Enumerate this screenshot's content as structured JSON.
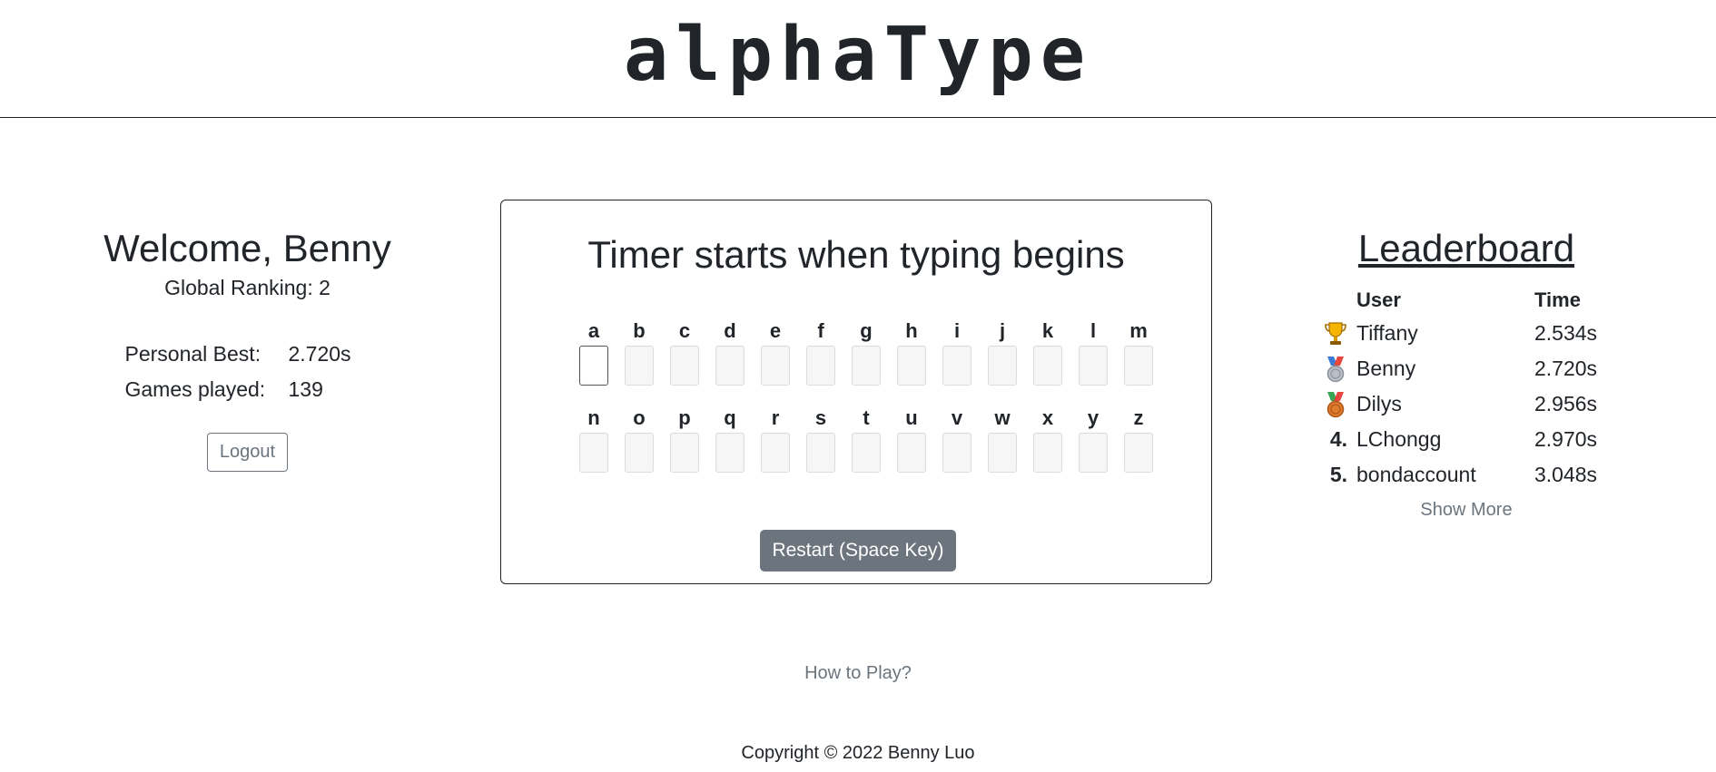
{
  "header": {
    "logo": "alphaType"
  },
  "profile": {
    "welcome": "Welcome, Benny",
    "ranking": "Global Ranking: 2",
    "stats": [
      {
        "label": "Personal Best:",
        "value": "2.720s"
      },
      {
        "label": "Games played:",
        "value": "139"
      }
    ],
    "logout_label": "Logout"
  },
  "game": {
    "title": "Timer starts when typing begins",
    "row1": [
      "a",
      "b",
      "c",
      "d",
      "e",
      "f",
      "g",
      "h",
      "i",
      "j",
      "k",
      "l",
      "m"
    ],
    "row2": [
      "n",
      "o",
      "p",
      "q",
      "r",
      "s",
      "t",
      "u",
      "v",
      "w",
      "x",
      "y",
      "z"
    ],
    "restart_label": "Restart (Space Key)"
  },
  "leaderboard": {
    "title": "Leaderboard",
    "headers": {
      "user": "User",
      "time": "Time"
    },
    "rows": [
      {
        "rank": "1.",
        "icon": "trophy-icon",
        "user": "Tiffany",
        "time": "2.534s"
      },
      {
        "rank": "2.",
        "icon": "silver-medal-icon",
        "user": "Benny",
        "time": "2.720s"
      },
      {
        "rank": "3.",
        "icon": "bronze-medal-icon",
        "user": "Dilys",
        "time": "2.956s"
      },
      {
        "rank": "4.",
        "icon": "",
        "user": "LChongg",
        "time": "2.970s"
      },
      {
        "rank": "5.",
        "icon": "",
        "user": "bondaccount",
        "time": "3.048s"
      }
    ],
    "show_more": "Show More"
  },
  "how_to_play": "How to Play?",
  "footer": {
    "copyright": "Copyright © 2022 Benny Luo"
  },
  "colors": {
    "text": "#212529",
    "muted": "#6c757d",
    "button": "#6c757d"
  }
}
